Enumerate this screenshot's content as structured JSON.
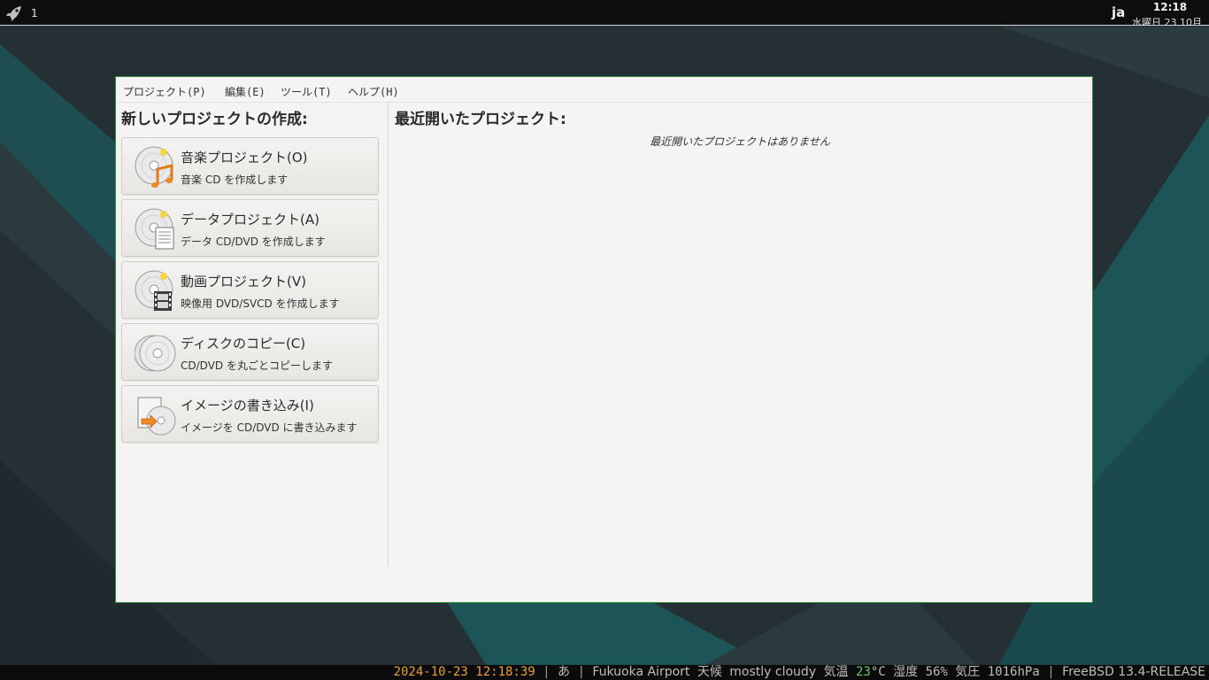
{
  "top_panel": {
    "workspace": "1",
    "language": "ja",
    "clock_time": "12:18",
    "clock_date": "水曜日 23 10月"
  },
  "menubar": {
    "items": [
      "プロジェクト(P)",
      "編集(E)",
      "ツール(T)",
      "ヘルプ(H)"
    ]
  },
  "new_project": {
    "heading": "新しいプロジェクトの作成:",
    "buttons": [
      {
        "title": "音楽プロジェクト(O)",
        "desc": "音楽 CD を作成します",
        "icon": "audio-cd-icon"
      },
      {
        "title": "データプロジェクト(A)",
        "desc": "データ CD/DVD を作成します",
        "icon": "data-cd-icon"
      },
      {
        "title": "動画プロジェクト(V)",
        "desc": "映像用 DVD/SVCD を作成します",
        "icon": "video-disc-icon"
      },
      {
        "title": "ディスクのコピー(C)",
        "desc": "CD/DVD を丸ごとコピーします",
        "icon": "disc-copy-icon"
      },
      {
        "title": "イメージの書き込み(I)",
        "desc": "イメージを CD/DVD に書き込みます",
        "icon": "burn-image-icon"
      }
    ]
  },
  "recent": {
    "heading": "最近開いたプロジェクト:",
    "empty_message": "最近開いたプロジェクトはありません"
  },
  "status_bar": {
    "datetime": "2024-10-23 12:18:39",
    "input_method": "あ",
    "location": "Fukuoka Airport",
    "weather_label": "天候",
    "weather": "mostly cloudy",
    "temp_label": "気温",
    "temp_value": "23",
    "temp_unit": "°C",
    "humidity_label": "湿度",
    "humidity": "56%",
    "pressure_label": "気圧",
    "pressure": "1016hPa",
    "os": "FreeBSD 13.4-RELEASE"
  },
  "colors": {
    "wallpaper_dark": "#253236",
    "wallpaper_teal": "#1d5a5e",
    "window_border": "#2f8f3a",
    "status_date": "#e6a23c",
    "status_temp": "#6ec36e"
  }
}
